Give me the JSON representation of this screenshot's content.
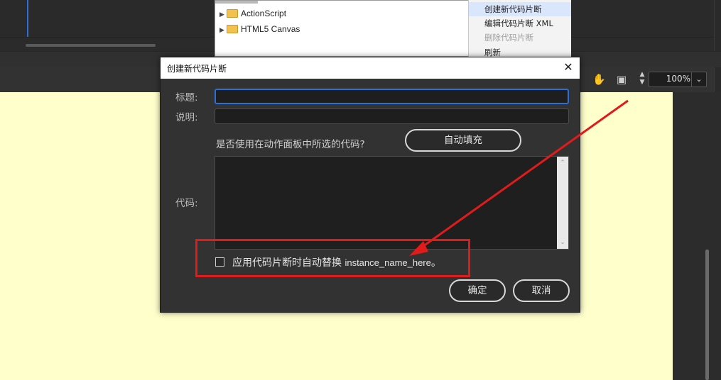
{
  "snippet_panel": {
    "tree": [
      {
        "label": "ActionScript"
      },
      {
        "label": "HTML5 Canvas"
      }
    ],
    "context_menu": [
      {
        "label": "创建新代码片断",
        "state": "hover"
      },
      {
        "label": "编辑代码片断 XML",
        "state": "normal"
      },
      {
        "label": "删除代码片断",
        "state": "disabled"
      },
      {
        "label": "刷新",
        "state": "normal"
      }
    ]
  },
  "toolbar": {
    "zoom_value": "100%",
    "icons": [
      "hand-icon",
      "clip-icon",
      "stepper-icon",
      "dropdown-icon"
    ]
  },
  "dialog": {
    "title": "创建新代码片断",
    "title_label": "标题:",
    "title_value": "",
    "desc_label": "说明:",
    "desc_value": "",
    "question": "是否使用在动作面板中所选的代码?",
    "autofill_button": "自动填充",
    "code_label": "代码:",
    "code_value": "",
    "checkbox_prefix": "应用代码片断时自动替换",
    "checkbox_token": "instance_name_here",
    "checkbox_suffix": "。",
    "checkbox_checked": false,
    "ok_button": "确定",
    "cancel_button": "取消"
  },
  "colors": {
    "accent": "#2d6fd8",
    "annotation": "#e01b1b",
    "stage": "#ffffcc"
  }
}
